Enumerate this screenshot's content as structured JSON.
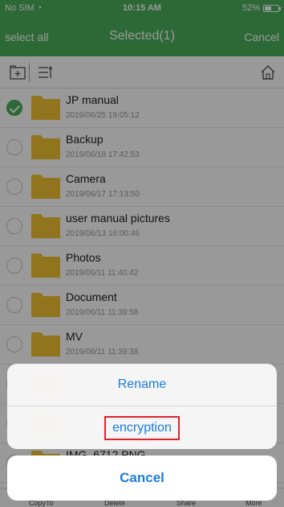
{
  "status": {
    "carrier": "No SIM",
    "time": "10:15 AM",
    "battery_text": "52%",
    "battery_level": 0.52
  },
  "nav": {
    "left": "select all",
    "title": "Selected(1)",
    "right": "Cancel"
  },
  "files": [
    {
      "name": "JP manual",
      "date": "2019/06/25 19:05:12",
      "selected": true
    },
    {
      "name": "Backup",
      "date": "2019/06/18 17:42:53",
      "selected": false
    },
    {
      "name": "Camera",
      "date": "2019/06/17 17:13:50",
      "selected": false
    },
    {
      "name": "user manual pictures",
      "date": "2019/06/13 16:00:46",
      "selected": false
    },
    {
      "name": "Photos",
      "date": "2019/06/11 11:40:42",
      "selected": false
    },
    {
      "name": "Document",
      "date": "2019/06/11 11:39:58",
      "selected": false
    },
    {
      "name": "MV",
      "date": "2019/06/11 11:39:38",
      "selected": false
    },
    {
      "name": "",
      "date": "",
      "selected": false
    },
    {
      "name": "",
      "date": "",
      "selected": false
    },
    {
      "name": "IMG_6712.PNG",
      "date": "",
      "selected": false
    }
  ],
  "bottombar": {
    "copy": "CopyTo",
    "delete": "Delete",
    "share": "Share",
    "more": "More"
  },
  "sheet": {
    "rename": "Rename",
    "encryption": "encryption",
    "cancel": "Cancel"
  },
  "colors": {
    "brand_green": "#4cb05a",
    "action_blue": "#1a7de0",
    "highlight_red": "#e0232e",
    "folder_yellow": "#f2c232"
  }
}
